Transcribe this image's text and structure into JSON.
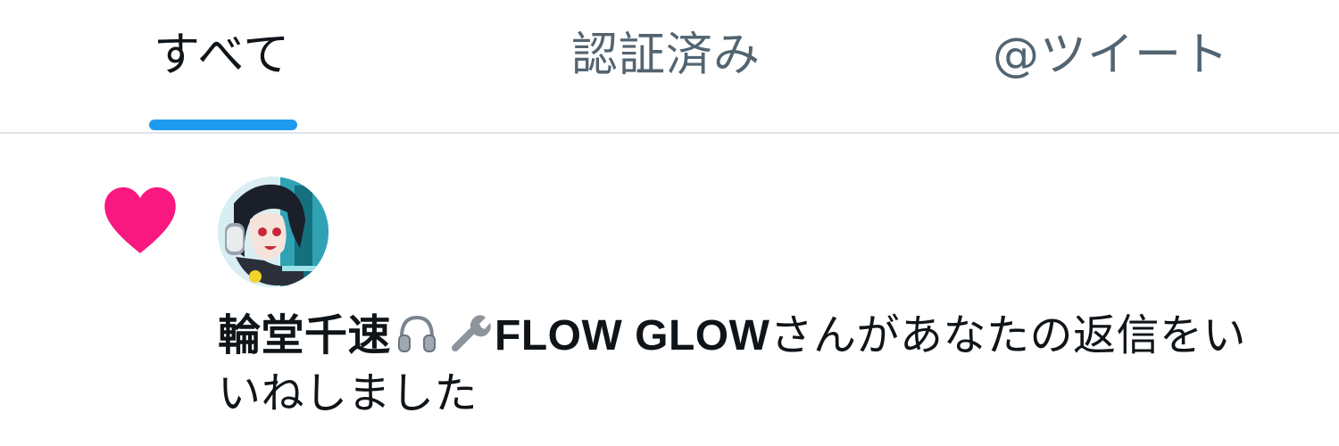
{
  "tabs": [
    {
      "label": "すべて",
      "active": true
    },
    {
      "label": "認証済み",
      "active": false
    },
    {
      "label": "@ツイート",
      "active": false
    }
  ],
  "colors": {
    "accent": "#1d9bf0",
    "heart": "#f91880",
    "text_primary": "#0f1419",
    "text_secondary": "#536471",
    "divider": "#e1e5ea"
  },
  "notification": {
    "icon": "heart-icon",
    "avatar_icon": "user-avatar",
    "user_name_prefix": "輪堂千速",
    "user_name_icons": [
      "headphones-icon",
      "wrench-icon"
    ],
    "user_name_suffix": "FLOW GLOW",
    "message_tail": "さんがあなたの返信をいいねしました"
  }
}
